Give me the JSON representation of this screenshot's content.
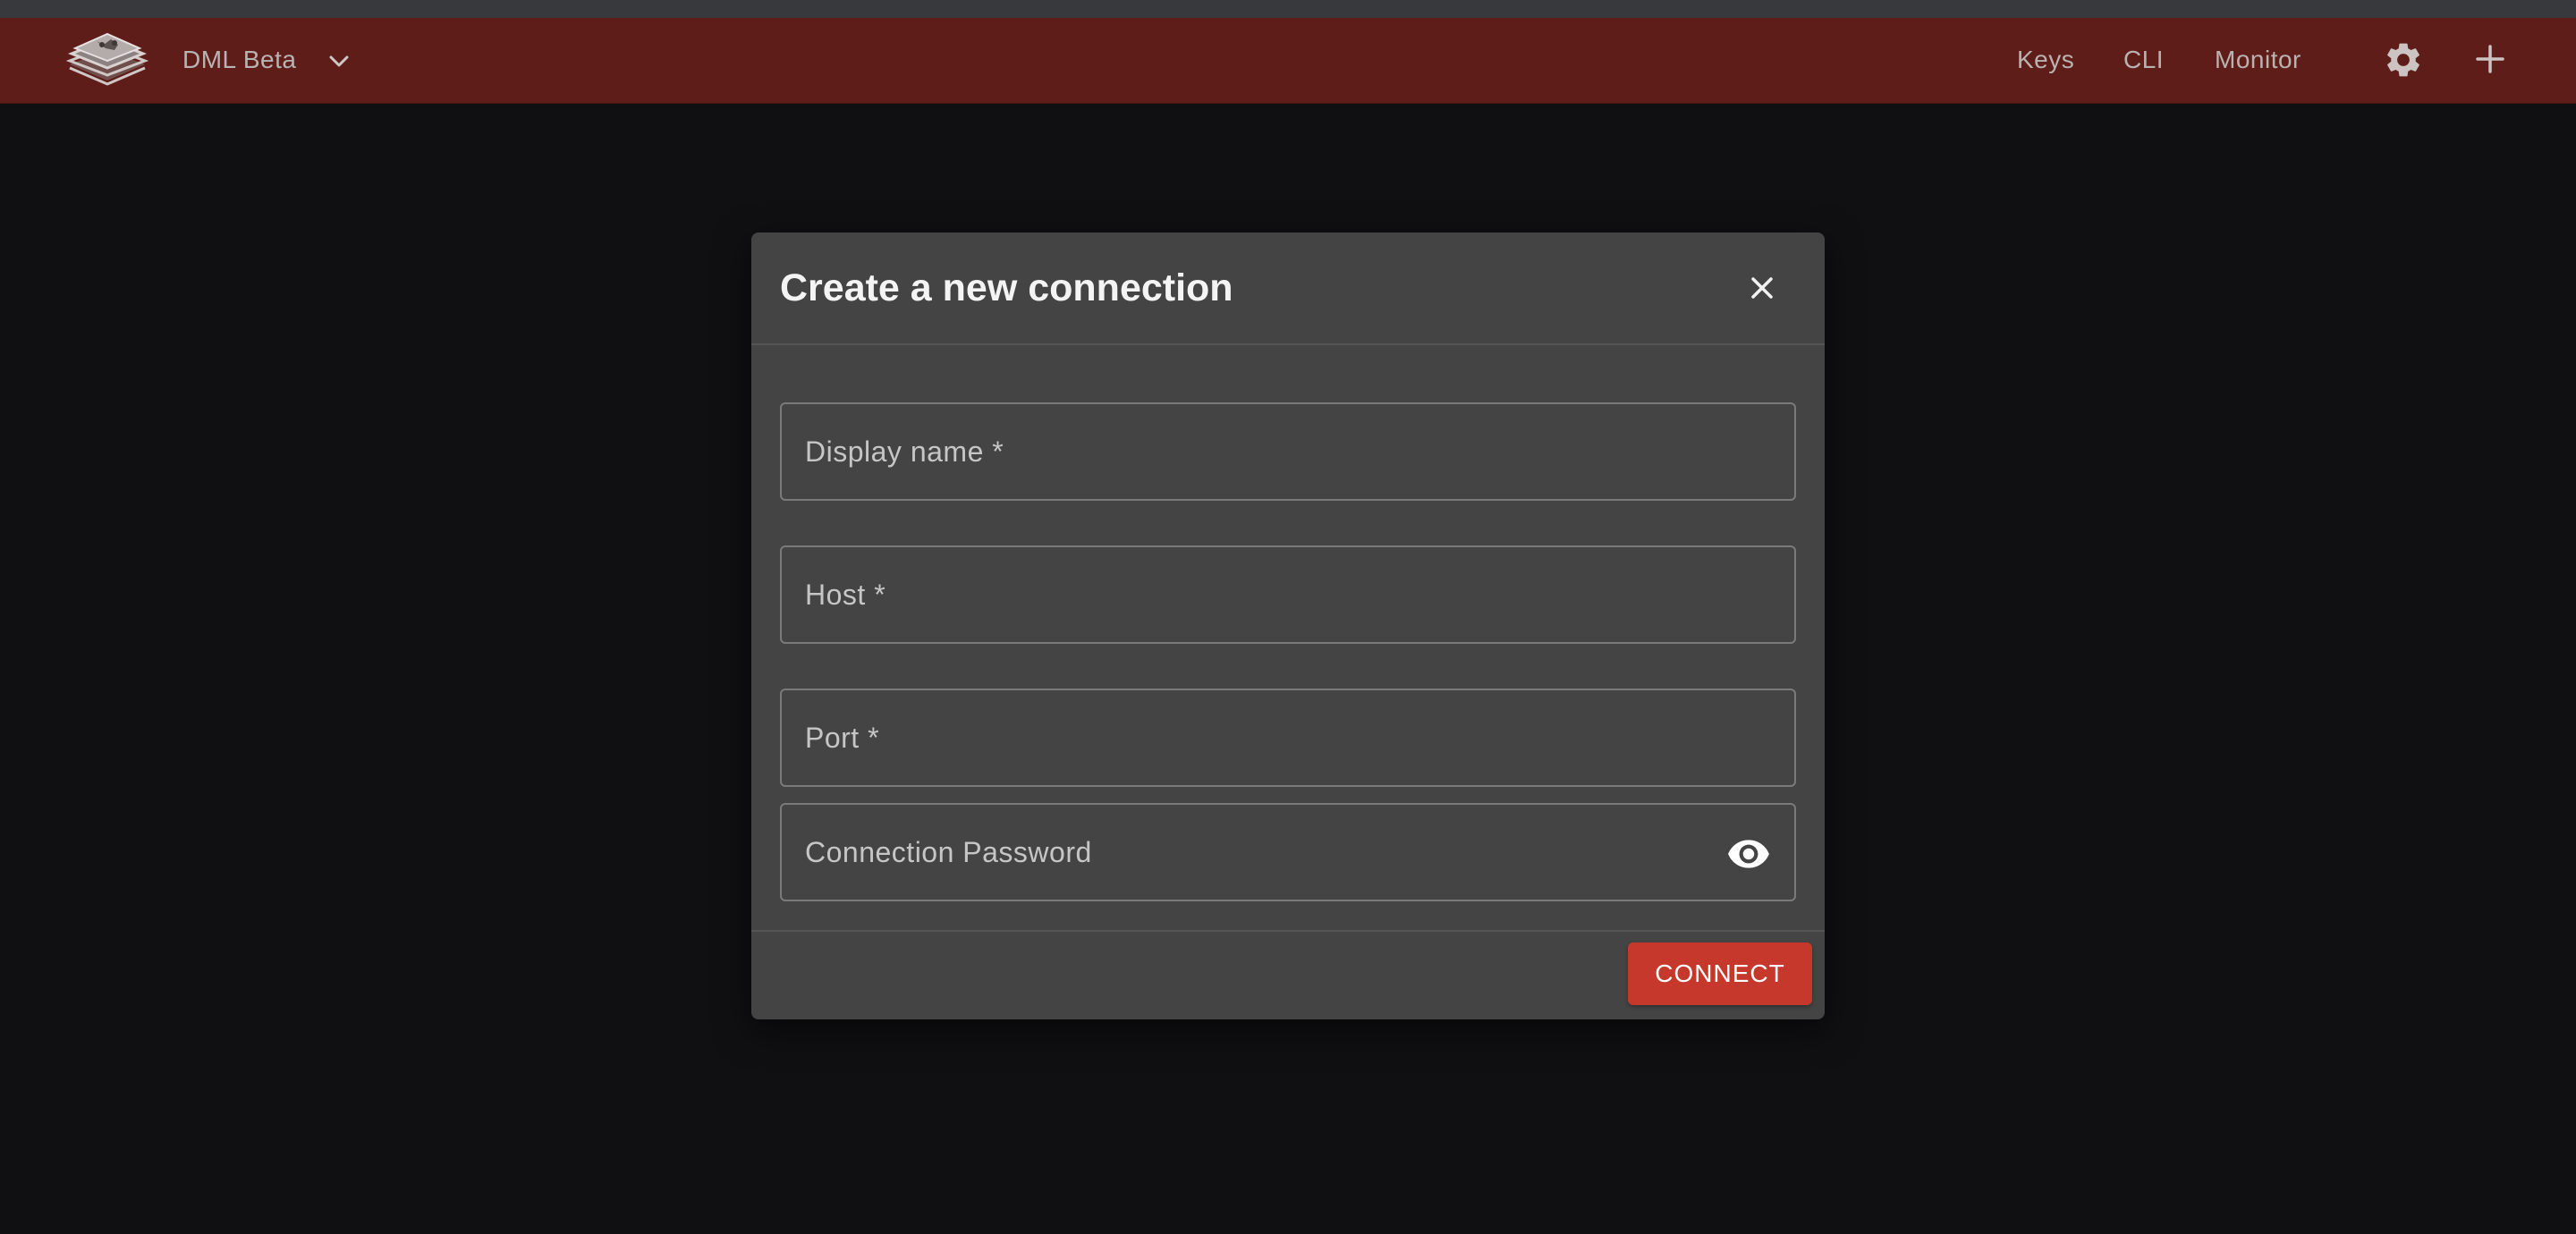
{
  "app": {
    "name": "DML Beta"
  },
  "nav": {
    "items": [
      {
        "label": "Keys"
      },
      {
        "label": "CLI"
      },
      {
        "label": "Monitor"
      }
    ]
  },
  "icons": {
    "logo": "layers-logo-icon",
    "app_switcher": "chevron-down-icon",
    "settings": "gear-icon",
    "add": "plus-icon",
    "close": "close-icon",
    "password_visibility": "eye-icon"
  },
  "modal": {
    "title": "Create a new connection",
    "fields": {
      "display_name": {
        "placeholder": "Display name *",
        "value": ""
      },
      "host": {
        "placeholder": "Host *",
        "value": ""
      },
      "port": {
        "placeholder": "Port *",
        "value": ""
      },
      "password": {
        "placeholder": "Connection Password",
        "value": ""
      }
    },
    "connect_label": "CONNECT"
  },
  "colors": {
    "topbar": "#5f1d1a",
    "background": "#101013",
    "modal": "#444444",
    "accent": "#c6382c"
  }
}
